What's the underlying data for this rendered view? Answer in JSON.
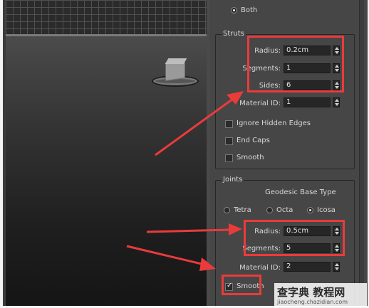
{
  "top_radio": {
    "label": "Both",
    "selected": true
  },
  "struts": {
    "title": "Struts",
    "radius": {
      "label": "Radius:",
      "value": "0.2cm"
    },
    "segments": {
      "label": "Segments:",
      "value": "1"
    },
    "sides": {
      "label": "Sides:",
      "value": "6"
    },
    "material_id": {
      "label": "Material ID:",
      "value": "1"
    },
    "ignore_hidden_edges": {
      "label": "Ignore Hidden Edges",
      "checked": false
    },
    "end_caps": {
      "label": "End Caps",
      "checked": false
    },
    "smooth": {
      "label": "Smooth",
      "checked": false
    }
  },
  "joints": {
    "title": "Joints",
    "base_type_label": "Geodesic Base Type",
    "base_types": [
      {
        "label": "Tetra",
        "selected": false
      },
      {
        "label": "Octa",
        "selected": false
      },
      {
        "label": "Icosa",
        "selected": true
      }
    ],
    "radius": {
      "label": "Radius:",
      "value": "0.5cm"
    },
    "segments": {
      "label": "Segments:",
      "value": "5"
    },
    "material_id": {
      "label": "Material ID:",
      "value": "2"
    },
    "smooth": {
      "label": "Smooth",
      "checked": true
    }
  },
  "colors": {
    "highlight": "#ea3b3b",
    "panel": "#464646",
    "field": "#262626"
  },
  "watermark": {
    "brand": "查字典 教程网",
    "url": "jiaocheng.chazidian.com"
  }
}
